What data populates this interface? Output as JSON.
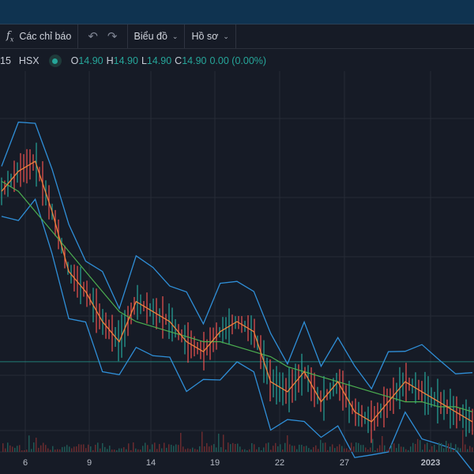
{
  "toolbar": {
    "indicators_label": "Các chỉ báo",
    "chart_menu_label": "Biểu đồ",
    "profile_menu_label": "Hồ sơ",
    "icons": [
      "fx-icon",
      "undo-icon",
      "redo-icon",
      "chevron-down-icon"
    ]
  },
  "legend": {
    "symbol_fragment": "15",
    "exchange": "HSX",
    "open_label": "O",
    "open": "14.90",
    "high_label": "H",
    "high": "14.90",
    "low_label": "L",
    "low": "14.90",
    "close_label": "C",
    "close": "14.90",
    "change": "0.00 (0.00%)",
    "status_color": "#26a69a"
  },
  "colors": {
    "background": "#161b26",
    "grid": "#262b36",
    "ma_short": "#f0823c",
    "ma_long": "#4caf50",
    "bollinger": "#2f8fd8",
    "price_line": "#26a69a",
    "up": "#26a69a",
    "down": "#ef5350"
  },
  "chart_data": {
    "type": "line",
    "x_ticks": [
      "6",
      "9",
      "14",
      "19",
      "22",
      "27",
      "2023"
    ],
    "series": [
      {
        "values": [
          16.6,
          16.8,
          16.9,
          16.4,
          15.8,
          15.6,
          15.3,
          15.1,
          15.5,
          15.4,
          15.3,
          15.1,
          15.0,
          15.2,
          15.3,
          15.2,
          14.7,
          14.6,
          14.8,
          14.5,
          14.7,
          14.4,
          14.3,
          14.5,
          14.7,
          14.6,
          14.5,
          14.4,
          14.3
        ]
      },
      {
        "values": [
          16.7,
          16.6,
          16.4,
          16.2,
          16.0,
          15.8,
          15.6,
          15.4,
          15.3,
          15.25,
          15.2,
          15.15,
          15.1,
          15.1,
          15.05,
          15.0,
          14.95,
          14.85,
          14.8,
          14.75,
          14.7,
          14.65,
          14.6,
          14.55,
          14.5,
          14.5,
          14.45,
          14.45,
          14.4
        ]
      }
    ],
    "price_line_value": 14.9
  }
}
